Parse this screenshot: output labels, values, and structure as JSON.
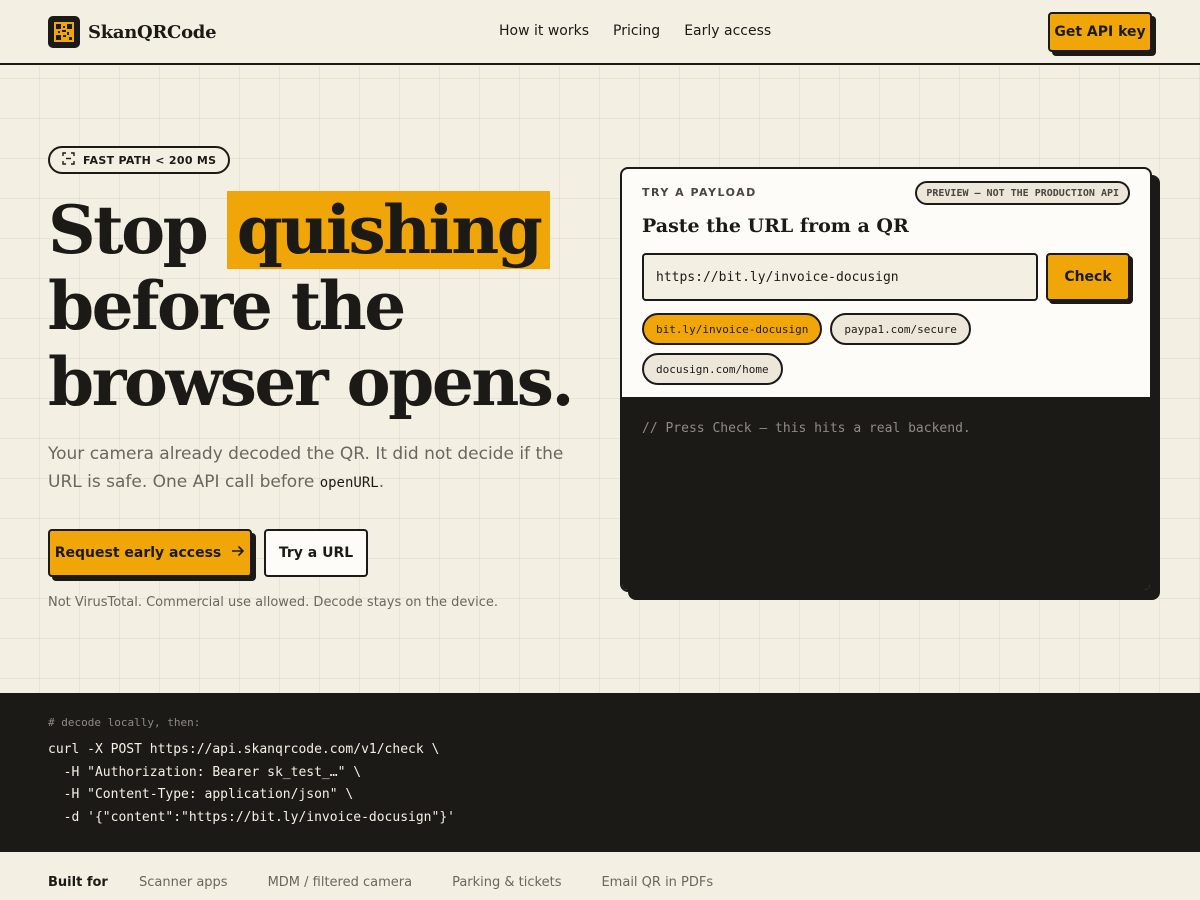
{
  "header": {
    "brand_name": "SkanQRCode",
    "nav": [
      {
        "label": "How it works"
      },
      {
        "label": "Pricing"
      },
      {
        "label": "Early access"
      }
    ],
    "cta_label": "Get API key"
  },
  "hero": {
    "badge_icon": "scan-frame-icon",
    "badge_text": "FAST PATH < 200 MS",
    "headline_pre": "Stop ",
    "headline_highlight": "quishing",
    "headline_line2": "before the",
    "headline_line3": "browser opens.",
    "lede_text": "Your camera already decoded the QR. It did not decide if the URL is safe. One API call before ",
    "lede_code": "openURL",
    "lede_end": ".",
    "primary_cta": "Request early access",
    "primary_cta_icon": "arrow-right-icon",
    "secondary_cta": "Try a URL",
    "footnote": "Not VirusTotal. Commercial use allowed. Decode stays on the device."
  },
  "panel": {
    "label": "TRY A PAYLOAD",
    "preview_badge": "PREVIEW — NOT THE PRODUCTION API",
    "title": "Paste the URL from a QR",
    "input_value": "https://bit.ly/invoice-docusign",
    "check_label": "Check",
    "chips": [
      {
        "label": "bit.ly/invoice-docusign",
        "active": true
      },
      {
        "label": "paypa1.com/secure",
        "active": false
      },
      {
        "label": "docusign.com/home",
        "active": false
      }
    ],
    "output_comment": "// Press Check — this hits a real backend."
  },
  "code": {
    "comment": "# decode locally, then:",
    "lines": [
      "curl -X POST https://api.skanqrcode.com/v1/check \\",
      "  -H \"Authorization: Bearer sk_test_…\" \\",
      "  -H \"Content-Type: application/json\" \\",
      "  -d '{\"content\":\"https://bit.ly/invoice-docusign\"}'"
    ]
  },
  "built_for": {
    "label": "Built for",
    "items": [
      "Scanner apps",
      "MDM / filtered camera",
      "Parking & tickets",
      "Email QR in PDFs"
    ]
  },
  "colors": {
    "accent": "#f0a608",
    "ink": "#1c1a17",
    "paper": "#f4efe3",
    "muted": "#6b6660"
  }
}
